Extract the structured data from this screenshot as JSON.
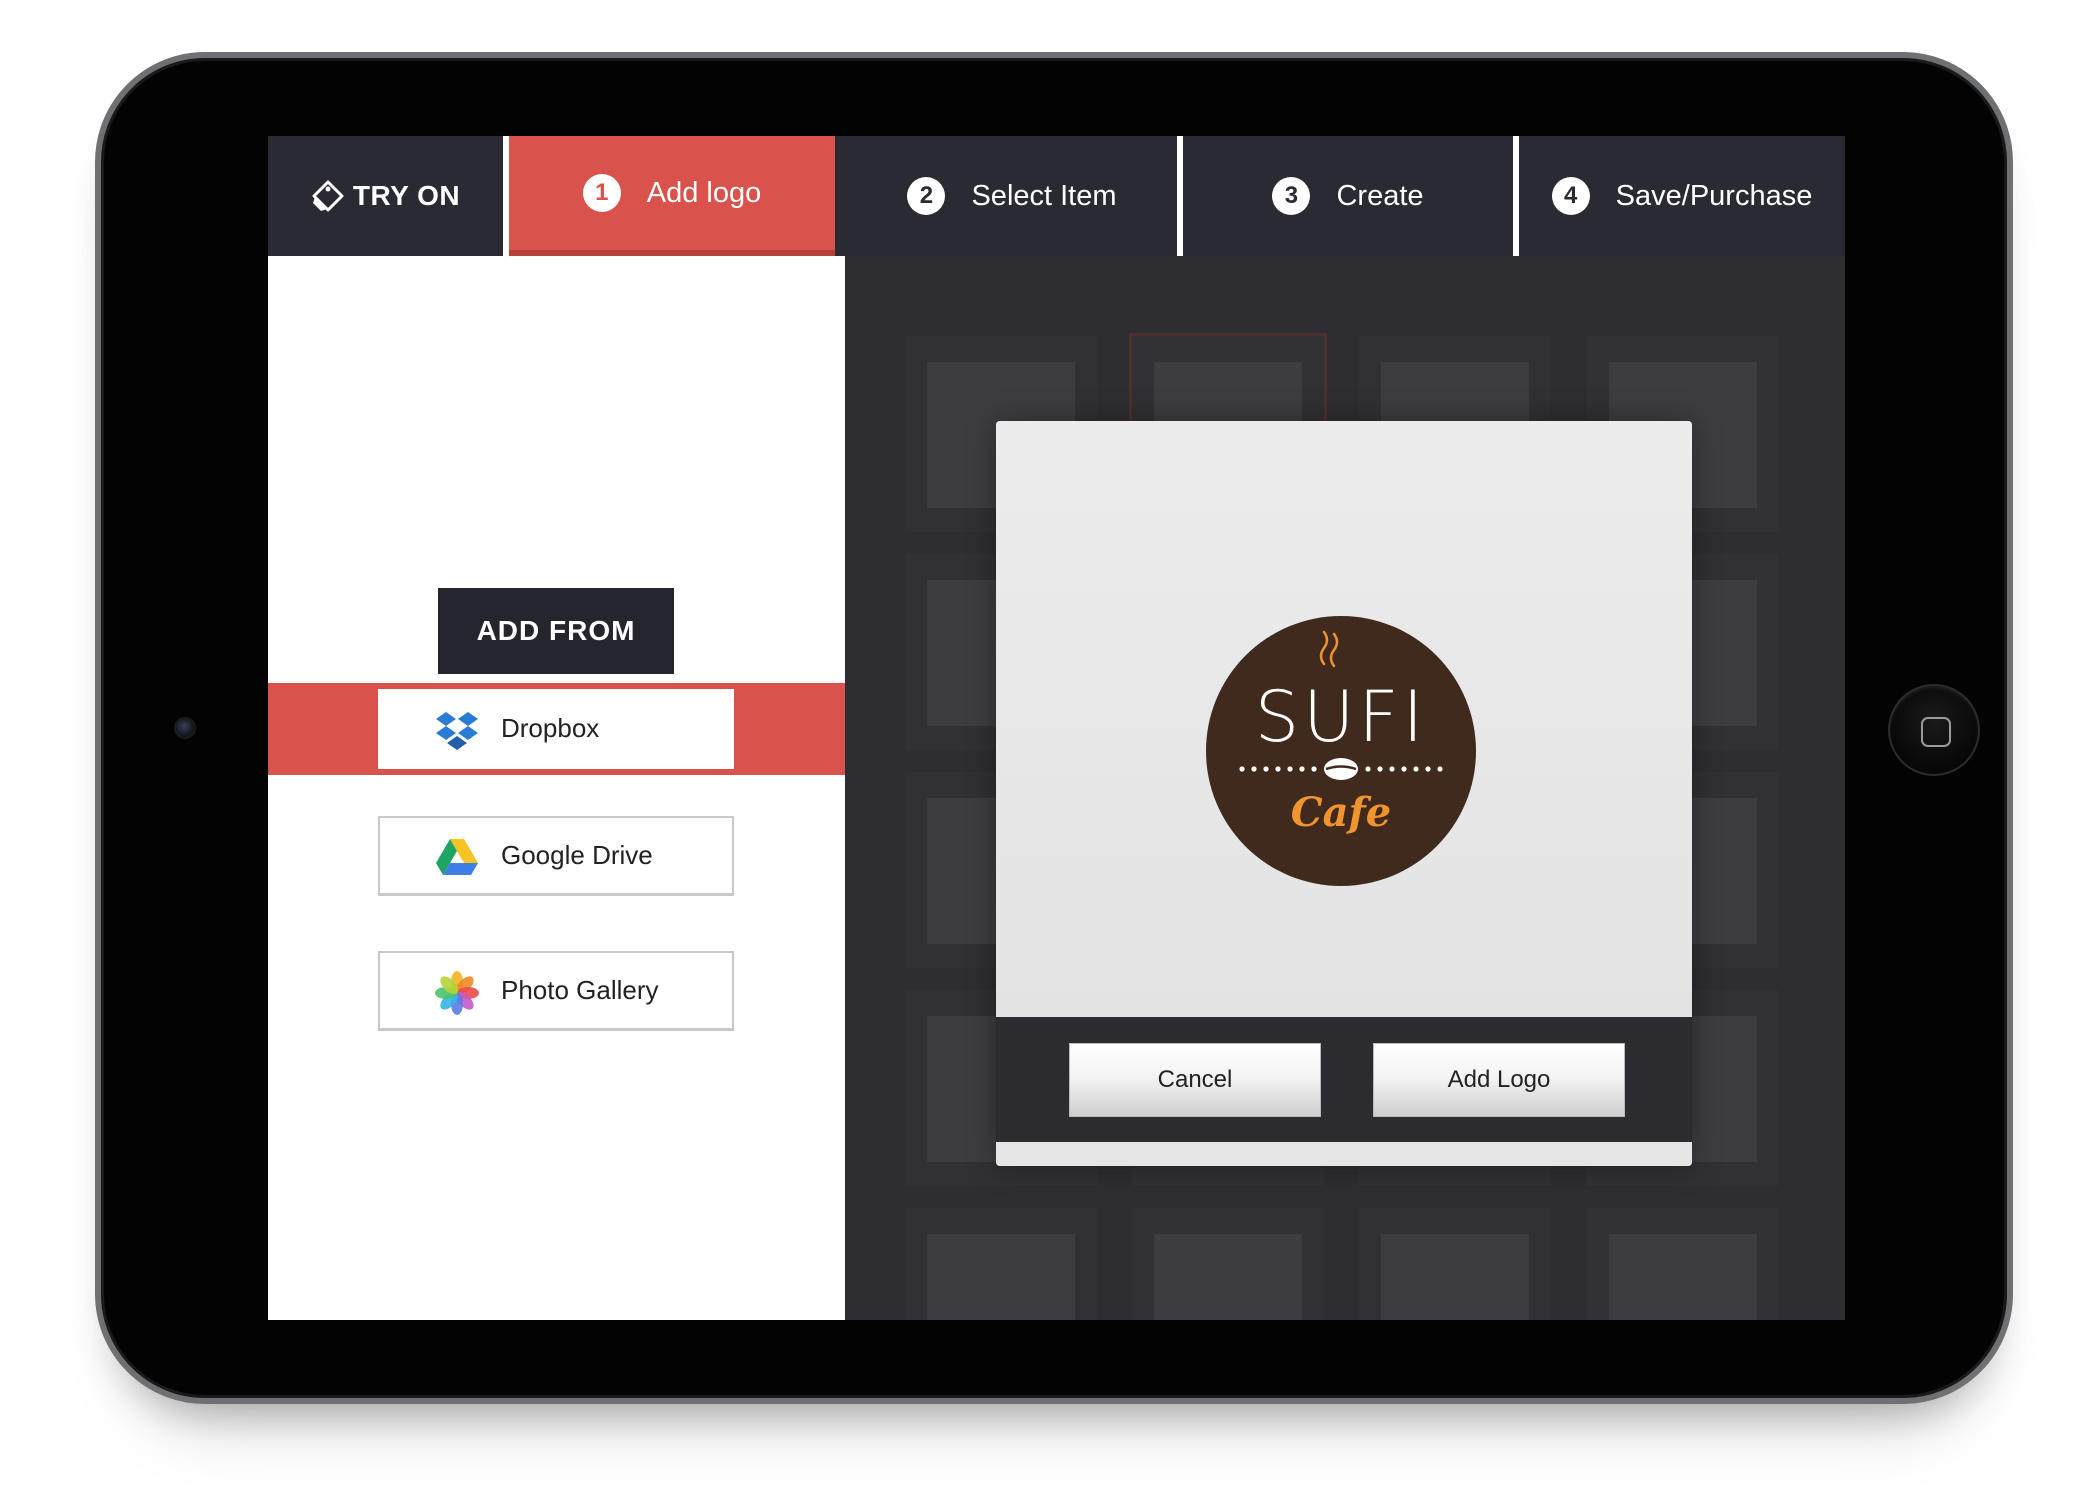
{
  "brand": {
    "name": "TRY ON",
    "icon": "tag-icon"
  },
  "steps": [
    {
      "number": "1",
      "label": "Add logo",
      "active": true
    },
    {
      "number": "2",
      "label": "Select Item",
      "active": false
    },
    {
      "number": "3",
      "label": "Create",
      "active": false
    },
    {
      "number": "4",
      "label": "Save/Purchase",
      "active": false
    }
  ],
  "sidebar": {
    "heading": "ADD FROM",
    "sources": [
      {
        "label": "Dropbox",
        "icon": "dropbox-icon",
        "selected": true
      },
      {
        "label": "Google Drive",
        "icon": "google-drive-icon",
        "selected": false
      },
      {
        "label": "Photo Gallery",
        "icon": "photo-gallery-icon",
        "selected": false
      }
    ]
  },
  "modal": {
    "logo": {
      "word": "SUFI",
      "subword": "Cafe"
    },
    "cancel_label": "Cancel",
    "add_label": "Add Logo"
  },
  "colors": {
    "accent": "#d9534c",
    "topbar": "#2a2a33",
    "logo_brown": "#3f2a1d",
    "logo_orange": "#f0952d"
  }
}
